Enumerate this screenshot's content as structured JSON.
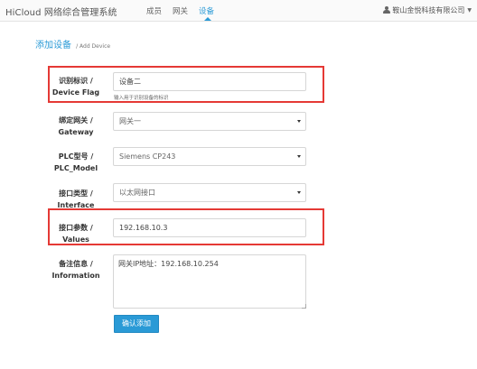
{
  "navbar": {
    "brand": "HiCloud 网络综合管理系统",
    "items": [
      {
        "label": "成员",
        "active": false
      },
      {
        "label": "网关",
        "active": false
      },
      {
        "label": "设备",
        "active": true
      }
    ],
    "user": "鞍山金悦科技有限公司",
    "accent_color": "#2a9ad6"
  },
  "page": {
    "title": "添加设备",
    "subtitle": "/ Add Device"
  },
  "form": {
    "device_flag": {
      "label_cn": "识别标识 /",
      "label_en": "Device Flag",
      "value": "设备二",
      "help": "输入用于识别设备的标识"
    },
    "gateway": {
      "label_cn": "绑定网关 /",
      "label_en": "Gateway",
      "value": "网关一"
    },
    "plc_model": {
      "label_cn": "PLC型号 /",
      "label_en": "PLC_Model",
      "value": "Siemens CP243"
    },
    "interface": {
      "label_cn": "接口类型 /",
      "label_en": "Interface",
      "value": "以太网接口"
    },
    "values": {
      "label_cn": "接口参数 /",
      "label_en": "Values",
      "value": "192.168.10.3"
    },
    "information": {
      "label_cn": "备注信息 /",
      "label_en": "Information",
      "value": "网关IP地址：192.168.10.254"
    },
    "submit_label": "确认添加"
  },
  "highlight_color": "#e53935",
  "icons": {
    "user": "user-icon",
    "select": "chevron-down-icon"
  }
}
